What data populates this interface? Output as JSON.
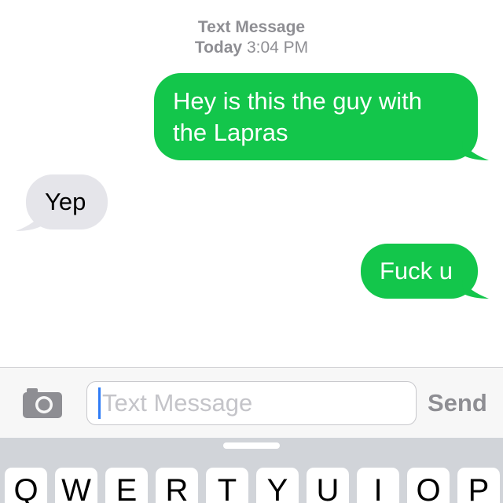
{
  "header": {
    "service": "Text Message",
    "day": "Today",
    "time": "3:04 PM"
  },
  "messages": [
    {
      "direction": "sent",
      "text": "Hey is this the guy with the Lapras"
    },
    {
      "direction": "received",
      "text": "Yep"
    },
    {
      "direction": "sent",
      "text": "Fuck u"
    }
  ],
  "input": {
    "placeholder": "Text Message",
    "send_label": "Send",
    "camera_icon": "camera-icon"
  },
  "keyboard": {
    "top_row": [
      "Q",
      "W",
      "E",
      "R",
      "T",
      "Y",
      "U",
      "I",
      "O",
      "P"
    ]
  },
  "colors": {
    "sent": "#13c64b",
    "received": "#e5e5ea",
    "caret": "#2f7cf6"
  }
}
